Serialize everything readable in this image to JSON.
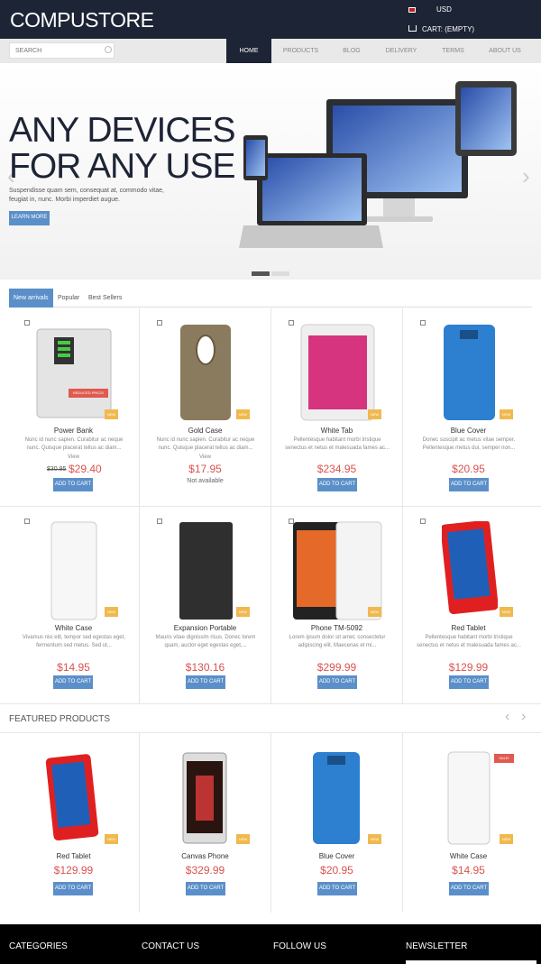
{
  "header": {
    "logo": "COMPUSTORE",
    "currency": "USD",
    "cart": "CART: (EMPTY)",
    "flag_icon": "us-flag-icon",
    "cart_icon": "cart-icon"
  },
  "search": {
    "placeholder": "SEARCH"
  },
  "nav": [
    "HOME",
    "PRODUCTS",
    "BLOG",
    "DELIVERY",
    "TERMS",
    "ABOUT US"
  ],
  "hero": {
    "title_line1": "ANY DEVICES",
    "title_line2": "FOR ANY USE",
    "text": "Suspendisse quam sem, consequat at, commodo vitae, feugiat in, nunc. Morbi imperdiet augue.",
    "button": "LEARN MORE",
    "prev_icon": "chevron-left-icon",
    "next_icon": "chevron-right-icon"
  },
  "tabs": [
    "New arrivals",
    "Popular",
    "Best Sellers"
  ],
  "products": [
    {
      "name": "Power Bank",
      "desc": "Nunc id nunc sapien. Curabitur ac neque nunc. Quisque placerat tellus ac diam...",
      "view": "View",
      "old_price": "$30.95",
      "price": "$29.40",
      "badge": "REDUCED PRICE!",
      "new": "NEW",
      "cta": "ADD TO CART"
    },
    {
      "name": "Gold Case",
      "desc": "Nunc id nunc sapien. Curabitur ac neque nunc. Quisque placerat tellus ac diam...",
      "view": "View",
      "price": "$17.95",
      "availability": "Not available",
      "new": "NEW"
    },
    {
      "name": "White Tab",
      "desc": "Pellentesque habitant morbi tristique senectus et netus et malesuada fames ac...",
      "view": "View",
      "price": "$234.95",
      "new": "NEW",
      "cta": "ADD TO CART"
    },
    {
      "name": "Blue Cover",
      "desc": "Donec suscipit ac metus vitae semper. Pellentesque metus dui, semper non...",
      "view": "View",
      "price": "$20.95",
      "new": "NEW",
      "cta": "ADD TO CART"
    },
    {
      "name": "White Case",
      "desc": "Vivamus nisi elit, tempor sed egestas eget, fermentum sed metus. Sed ut...",
      "view": "View",
      "price": "$14.95",
      "new": "NEW",
      "cta": "ADD TO CART"
    },
    {
      "name": "Expansion Portable",
      "desc": "Mauris vitae dignissim risus. Donec lorem quam, auctor eget egestas eget,...",
      "view": "View",
      "price": "$130.16",
      "new": "NEW",
      "cta": "ADD TO CART"
    },
    {
      "name": "Phone TM-5092",
      "desc": "Lorem ipsum dolor sit amet, consectetur adipiscing elit. Maecenas et mi...",
      "view": "View",
      "price": "$299.99",
      "new": "NEW",
      "cta": "ADD TO CART"
    },
    {
      "name": "Red Tablet",
      "desc": "Pellentesque habitant morbi tristique senectus et netus et malesuada fames ac...",
      "view": "View",
      "price": "$129.99",
      "new": "NEW",
      "cta": "ADD TO CART"
    }
  ],
  "featured": {
    "title": "FEATURED PRODUCTS",
    "items": [
      {
        "name": "Red Tablet",
        "price": "$129.99",
        "new": "NEW",
        "cta": "ADD TO CART"
      },
      {
        "name": "Canvas Phone",
        "price": "$329.99",
        "new": "NEW",
        "cta": "ADD TO CART"
      },
      {
        "name": "Blue Cover",
        "price": "$20.95",
        "new": "NEW",
        "cta": "ADD TO CART"
      },
      {
        "name": "White Case",
        "price": "$14.95",
        "new": "NEW",
        "sale": "SALE!",
        "cta": "ADD TO CART"
      }
    ]
  },
  "footer": [
    "CATEGORIES",
    "CONTACT US",
    "FOLLOW US",
    "NEWSLETTER"
  ],
  "colors": {
    "dark": "#1d2435",
    "accent": "#5b8fc9",
    "price": "#d9534f",
    "badge": "#f0b94e"
  }
}
